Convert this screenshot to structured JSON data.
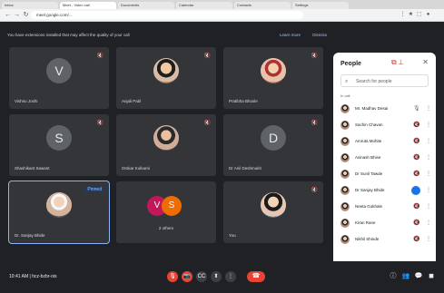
{
  "browser": {
    "tabs": [
      {
        "label": "Inbox"
      },
      {
        "label": "Meet - Video call"
      },
      {
        "label": "Documents"
      },
      {
        "label": "Calendar"
      },
      {
        "label": "Contacts"
      },
      {
        "label": "Settings"
      }
    ],
    "url": "meet.google.com/..."
  },
  "meet": {
    "banner_message": "You have extensions installed that may affect the quality of your call",
    "banner_actions": [
      "Learn more",
      "Dismiss"
    ],
    "tiles": [
      {
        "type": "letter",
        "letter": "V",
        "name": "Vishnu Joshi"
      },
      {
        "type": "photo",
        "variant": "p2",
        "name": "Anjali Patil"
      },
      {
        "type": "photo",
        "variant": "p3",
        "name": "Pratibha Bhosle"
      },
      {
        "type": "letter",
        "letter": "S",
        "name": "Shashikant Sawant"
      },
      {
        "type": "photo",
        "variant": "p4",
        "name": "Omkar Kulkarni"
      },
      {
        "type": "letter",
        "letter": "D",
        "name": "Dr Anil Deshmukh"
      },
      {
        "type": "photo",
        "variant": "p6",
        "name": "Dr. Sanjay Bhide",
        "highlight": true,
        "pin_label": "Pinned"
      },
      {
        "type": "duo",
        "letters": [
          "V",
          "S"
        ],
        "name": "2 others"
      },
      {
        "type": "photo",
        "variant": "p5",
        "name": "You"
      }
    ]
  },
  "people_panel": {
    "title": "People",
    "search_placeholder": "Search for people",
    "section_label": "In call",
    "people": [
      {
        "name": "Mr. Madhav Desai"
      },
      {
        "name": "Sachin Chavan"
      },
      {
        "name": "Amruta Mohite"
      },
      {
        "name": "Avinash Bhise"
      },
      {
        "name": "Dr Sunil Tawde"
      },
      {
        "name": "Dr Sanjay Bhide",
        "speaking": true
      },
      {
        "name": "Neeta Gokhale"
      },
      {
        "name": "Kiran Rane"
      },
      {
        "name": "Nikhil Shinde"
      }
    ]
  },
  "bottom_bar": {
    "meeting_time": "10:41 AM",
    "meeting_code": "hcz-bzbr-ois"
  }
}
